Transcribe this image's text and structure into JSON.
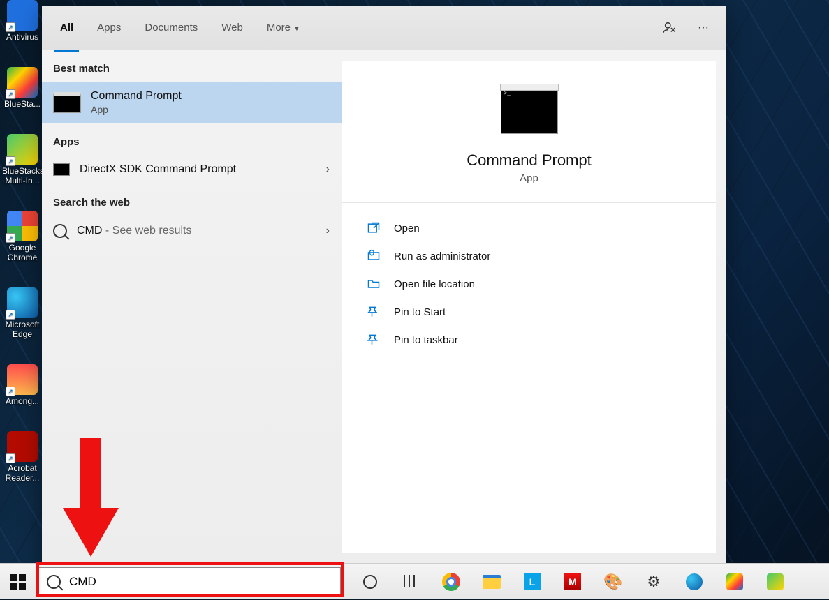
{
  "desktop": {
    "icons": [
      {
        "label": "Antivirus"
      },
      {
        "label": "BlueSta..."
      },
      {
        "label": "BlueStacks Multi-In..."
      },
      {
        "label": "Google Chrome"
      },
      {
        "label": "Microsoft Edge"
      },
      {
        "label": "Among..."
      },
      {
        "label": "Acrobat Reader..."
      }
    ]
  },
  "tabs": {
    "all": "All",
    "apps": "Apps",
    "documents": "Documents",
    "web": "Web",
    "more": "More"
  },
  "left": {
    "best_match_label": "Best match",
    "best_match": {
      "title": "Command Prompt",
      "subtitle": "App"
    },
    "apps_label": "Apps",
    "apps": [
      {
        "title": "DirectX SDK Command Prompt"
      }
    ],
    "web_label": "Search the web",
    "web": [
      {
        "term": "CMD",
        "suffix": " - See web results"
      }
    ]
  },
  "detail": {
    "title": "Command Prompt",
    "subtitle": "App",
    "actions": {
      "open": "Open",
      "run_admin": "Run as administrator",
      "open_loc": "Open file location",
      "pin_start": "Pin to Start",
      "pin_taskbar": "Pin to taskbar"
    }
  },
  "search": {
    "value": "CMD"
  }
}
